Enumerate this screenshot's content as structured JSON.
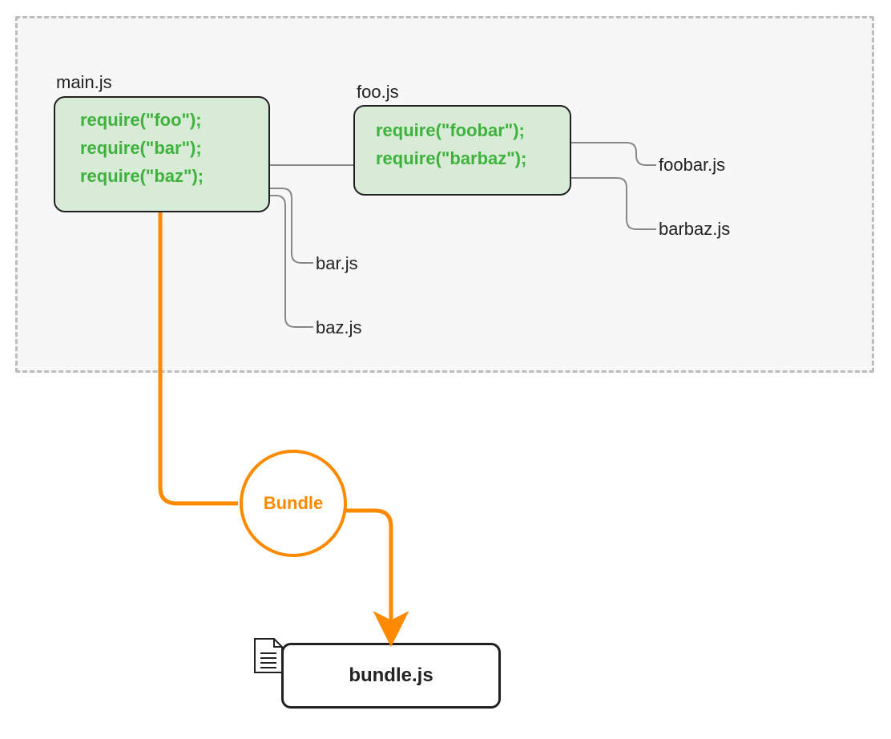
{
  "modules": {
    "main": {
      "label": "main.js",
      "code": "require(\"foo\");\nrequire(\"bar\");\nrequire(\"baz\");"
    },
    "foo": {
      "label": "foo.js",
      "code": "require(\"foobar\");\nrequire(\"barbaz\");"
    }
  },
  "files": {
    "bar": "bar.js",
    "baz": "baz.js",
    "foobar": "foobar.js",
    "barbaz": "barbaz.js"
  },
  "bundle": {
    "process_label": "Bundle",
    "output_label": "bundle.js"
  },
  "colors": {
    "dashed_border": "#bdbdbd",
    "container_bg": "#f7f7f7",
    "box_fill": "#d8ebd6",
    "code_green": "#3fb23d",
    "orange": "#ff8a00",
    "connector_gray": "#888888",
    "black": "#202020"
  }
}
